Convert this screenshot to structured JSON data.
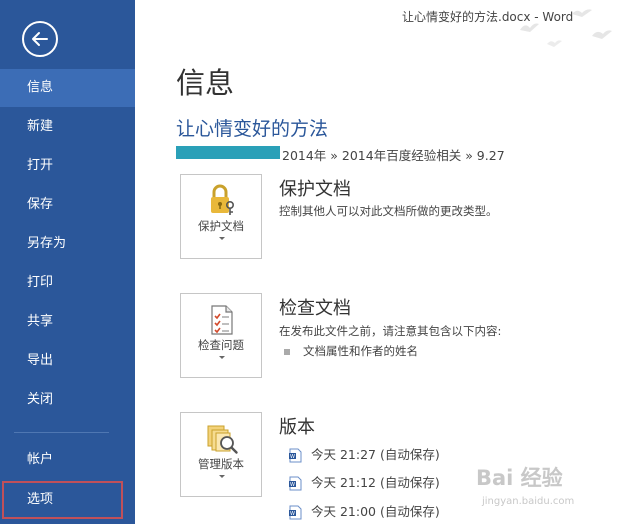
{
  "window": {
    "title": "让心情变好的方法.docx - Word"
  },
  "sidebar": {
    "items": [
      {
        "label": "信息"
      },
      {
        "label": "新建"
      },
      {
        "label": "打开"
      },
      {
        "label": "保存"
      },
      {
        "label": "另存为"
      },
      {
        "label": "打印"
      },
      {
        "label": "共享"
      },
      {
        "label": "导出"
      },
      {
        "label": "关闭"
      },
      {
        "label": "帐户"
      },
      {
        "label": "选项"
      }
    ]
  },
  "main": {
    "page_title": "信息",
    "doc_title": "让心情变好的方法",
    "path": "2014年 » 2014年百度经验相关 » 9.27",
    "protect": {
      "tile_label": "保护文档",
      "title": "保护文档",
      "description": "控制其他人可以对此文档所做的更改类型。"
    },
    "inspect": {
      "tile_label": "检查问题",
      "title": "检查文档",
      "description": "在发布此文件之前，请注意其包含以下内容:",
      "bullets": [
        "文档属性和作者的姓名"
      ]
    },
    "versions": {
      "tile_label": "管理版本",
      "title": "版本",
      "items": [
        {
          "label": "今天 21:27 (自动保存)"
        },
        {
          "label": "今天 21:12 (自动保存)"
        },
        {
          "label": "今天 21:00 (自动保存)"
        }
      ]
    }
  },
  "watermark": {
    "main": "Bai 经验",
    "sub": "jingyan.baidu.com"
  },
  "colors": {
    "sidebar_bg": "#2b579a",
    "sidebar_active": "#3c6db6",
    "accent_title": "#2b579a",
    "highlight_border": "#c0505a",
    "redaction": "#2aa0b8"
  }
}
